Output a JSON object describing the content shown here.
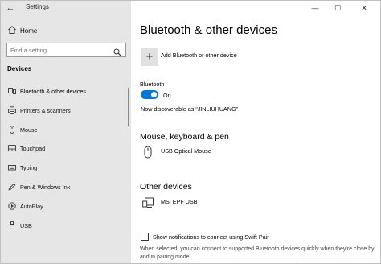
{
  "window": {
    "title": "Settings",
    "back": "←",
    "minimize": "—",
    "maximize": "☐",
    "close": "✕"
  },
  "sidebar": {
    "home_label": "Home",
    "search_placeholder": "Find a setting",
    "section_title": "Devices",
    "items": [
      {
        "label": "Bluetooth & other devices",
        "icon": "bluetooth-devices-icon",
        "active": true
      },
      {
        "label": "Printers & scanners",
        "icon": "printer-icon"
      },
      {
        "label": "Mouse",
        "icon": "mouse-icon"
      },
      {
        "label": "Touchpad",
        "icon": "touchpad-icon"
      },
      {
        "label": "Typing",
        "icon": "keyboard-icon"
      },
      {
        "label": "Pen & Windows Ink",
        "icon": "pen-icon"
      },
      {
        "label": "AutoPlay",
        "icon": "autoplay-icon"
      },
      {
        "label": "USB",
        "icon": "usb-icon"
      }
    ]
  },
  "main": {
    "title": "Bluetooth & other devices",
    "add_device_label": "Add Bluetooth or other device",
    "bluetooth": {
      "label": "Bluetooth",
      "toggle_state": "On",
      "discoverable_text": "Now discoverable as “JINLIUHUANG”"
    },
    "mouse_keyboard_pen": {
      "title": "Mouse, keyboard & pen",
      "devices": [
        {
          "name": "USB Optical Mouse",
          "icon": "mouse-icon"
        }
      ]
    },
    "other_devices": {
      "title": "Other devices",
      "devices": [
        {
          "name": "MSI EPF USB",
          "icon": "device-icon"
        }
      ]
    },
    "swift_pair": {
      "checkbox_label": "Show notifications to connect using Swift Pair",
      "checked": false,
      "description": "When selected, you can connect to supported Bluetooth devices quickly when they're close by and in pairing mode."
    }
  },
  "colors": {
    "accent": "#0078d7",
    "sidebar_bg": "#e6e6e6"
  }
}
